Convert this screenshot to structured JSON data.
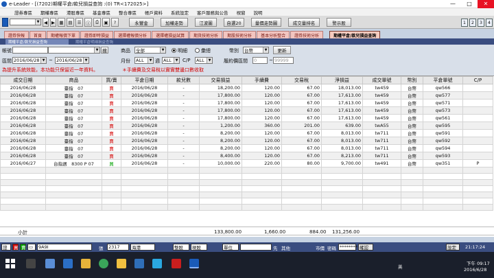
{
  "window": {
    "title": "e-Leader - [(7202)期權平倉/款兒損益查詢 :(0) TR<172025>]",
    "min": "—",
    "max": "□",
    "close": "✕"
  },
  "menu": [
    "證券專區",
    "期權專區",
    "港股專區",
    "基金專區",
    "整合專區",
    "帳戶資料",
    "系統設定",
    "客戶服務與公告",
    "視窗",
    "說明"
  ],
  "toolbar": {
    "account": "",
    "buttons": [
      "永豐金",
      "加權走勢",
      "江波圖",
      "自選20",
      "量價走勢圖",
      "成交量排名",
      "警示股"
    ],
    "pages": [
      "1",
      "2",
      "3",
      "4"
    ]
  },
  "tabs": [
    "證券快報",
    "首頁",
    "期權報價下單",
    "證券即時損益",
    "選擇權報價分析",
    "選擇權損益試算",
    "期貨技術分析",
    "期股技術分析",
    "基本分析整合",
    "證券技術分析",
    "期權平倉/款兒損益查詢"
  ],
  "subtabs": [
    "期權平倉/款兒損益查詢",
    "期權平倉明細損益查詢"
  ],
  "query": {
    "account_label": "帳號",
    "account_value": "",
    "search_btn": "搜",
    "product_label": "商品",
    "product_value": "全部",
    "radio_detail": "明細",
    "radio_total": "彙總",
    "currency_label": "幣別",
    "currency_value": "台幣",
    "refresh_btn": "更新",
    "range_label": "區間",
    "date_from": "2016/06/28",
    "date_to": "2016/06/28",
    "month_label": "月份",
    "month_value": "ALL",
    "week_label": "週",
    "week_value": "ALL",
    "cp_label": "C/P",
    "cp_value": "ALL",
    "strike_label": "履約價區間",
    "strike_from": "0",
    "strike_to": "99999",
    "warning": "為提升系統效能，本功能只保留近一年資料。",
    "notice": "＊手續費及交易稅以實實雙邊口數收取"
  },
  "table": {
    "columns": [
      "成交日期",
      "商品",
      "買/賣",
      "平倉日期",
      "款兒數",
      "交易損益",
      "手續費",
      "交易稅",
      "淨損益",
      "成交單號",
      "幣別",
      "平倉單號",
      "C/P"
    ],
    "rows": [
      [
        "2016/06/28",
        "臺指　07",
        "賣",
        "2016/06/28",
        "-",
        "18,200.00",
        "120.00",
        "67.00",
        "18,013.00",
        "tw459",
        "台幣",
        "qw566",
        ""
      ],
      [
        "2016/06/28",
        "臺指　07",
        "賣",
        "2016/06/28",
        "-",
        "17,800.00",
        "120.00",
        "67.00",
        "17,613.00",
        "tw459",
        "台幣",
        "qw577",
        ""
      ],
      [
        "2016/06/28",
        "臺指　07",
        "賣",
        "2016/06/28",
        "-",
        "17,800.00",
        "120.00",
        "67.00",
        "17,613.00",
        "tw459",
        "台幣",
        "qw571",
        ""
      ],
      [
        "2016/06/28",
        "臺指　07",
        "賣",
        "2016/06/28",
        "-",
        "17,800.00",
        "120.00",
        "67.00",
        "17,613.00",
        "tw459",
        "台幣",
        "qw573",
        ""
      ],
      [
        "2016/06/28",
        "臺指　07",
        "賣",
        "2016/06/28",
        "-",
        "17,800.00",
        "120.00",
        "67.00",
        "17,613.00",
        "tw459",
        "台幣",
        "qw561",
        ""
      ],
      [
        "2016/06/28",
        "臺指　07",
        "賣",
        "2016/06/28",
        "-",
        "1,200.00",
        "360.00",
        "201.00",
        "639.00",
        "twA55",
        "台幣",
        "qw595",
        ""
      ],
      [
        "2016/06/28",
        "臺指　07",
        "賣",
        "2016/06/28",
        "-",
        "8,200.00",
        "120.00",
        "67.00",
        "8,013.00",
        "tw711",
        "台幣",
        "qw591",
        ""
      ],
      [
        "2016/06/28",
        "臺指　07",
        "賣",
        "2016/06/28",
        "-",
        "8,200.00",
        "120.00",
        "67.00",
        "8,013.00",
        "tw711",
        "台幣",
        "qw592",
        ""
      ],
      [
        "2016/06/28",
        "臺指　07",
        "賣",
        "2016/06/28",
        "-",
        "8,200.00",
        "120.00",
        "67.00",
        "8,013.00",
        "tw711",
        "台幣",
        "qw594",
        ""
      ],
      [
        "2016/06/28",
        "臺指　07",
        "賣",
        "2016/06/28",
        "-",
        "8,400.00",
        "120.00",
        "67.00",
        "8,213.00",
        "tw711",
        "台幣",
        "qw593",
        ""
      ],
      [
        "2016/06/27",
        "台指週　8300 P 07",
        "買",
        "2016/06/28",
        "-",
        "10,000.00",
        "220.00",
        "80.00",
        "9,700.00",
        "tw491",
        "台幣",
        "qw351",
        "P"
      ]
    ],
    "empty_rows": 7
  },
  "summary": {
    "label": "小計",
    "pnl": "133,800.00",
    "fee": "1,660.00",
    "tax": "884.00",
    "net": "131,256.00"
  },
  "statusbar": {
    "sym": "證",
    "buy": "買",
    "sell": "賣",
    "code": "9A9I",
    "qty_label": "張",
    "qty": "2317",
    "exch": "海港",
    "ord_type": "整股",
    "cash": "現股",
    "price_label": "單位",
    "chk1": "先",
    "chk2": "其他",
    "cond": "市價",
    "pwd_label": "密碼",
    "pwd": "********",
    "confirm": "確認",
    "setting": "設定",
    "clock": "21:17:24"
  },
  "taskbar": {
    "ime": "英",
    "time": "下午 09:17",
    "date": "2016/6/28"
  }
}
